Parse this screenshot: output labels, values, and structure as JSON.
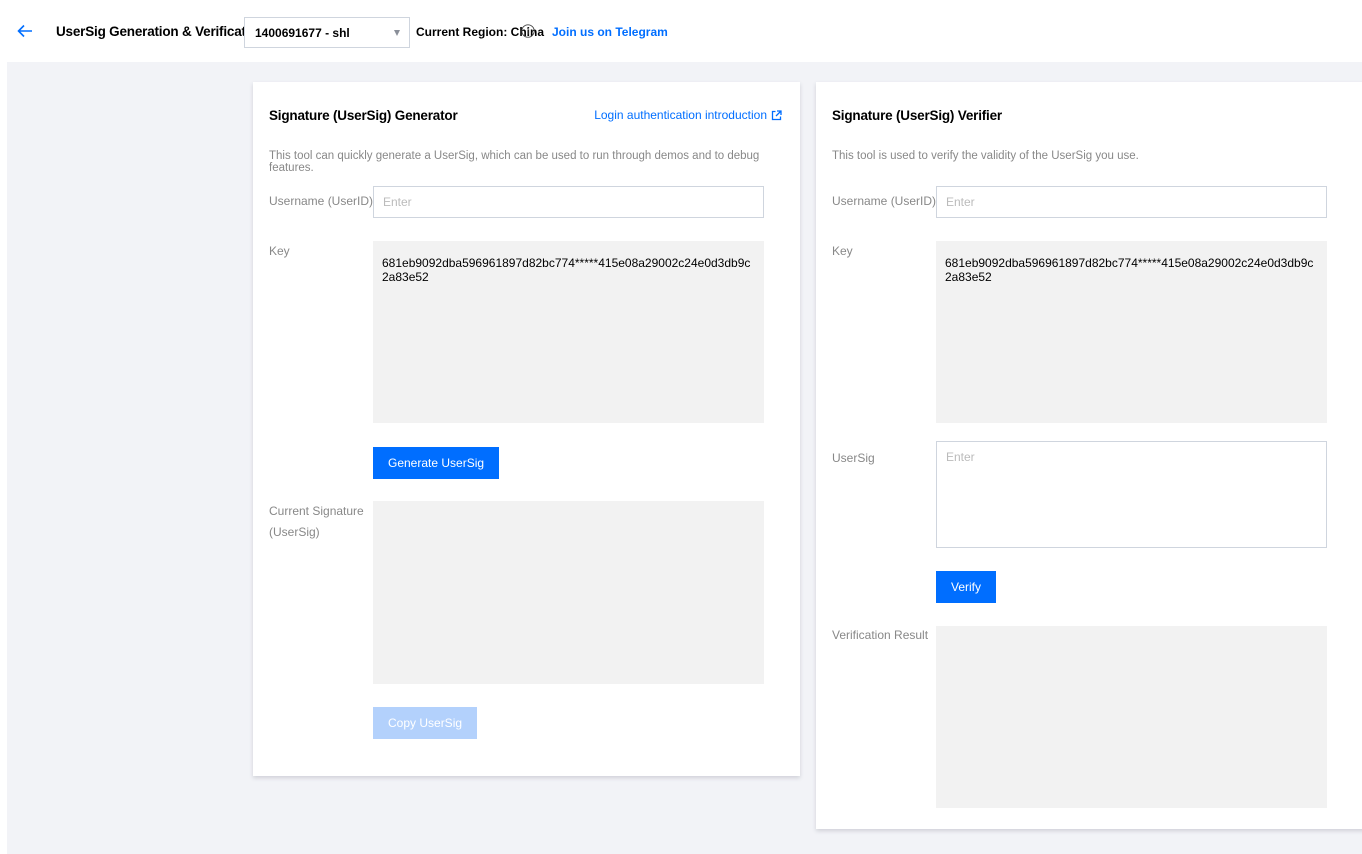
{
  "header": {
    "title": "UserSig Generation & Verification",
    "app_selector_value": "1400691677 - shl",
    "region_label": "Current Region: China",
    "telegram_link": "Join us on Telegram"
  },
  "generator": {
    "title": "Signature (UserSig) Generator",
    "doc_link": "Login authentication introduction",
    "description": "This tool can quickly generate a UserSig, which can be used to run through demos and to debug features.",
    "username_label": "Username (UserID)",
    "username_value": "",
    "username_placeholder": "Enter",
    "key_label": "Key",
    "key_value": "681eb9092dba596961897d82bc774*****415e08a29002c24e0d3db9c2a83e52",
    "generate_button": "Generate UserSig",
    "current_sig_label_line1": "Current Signature",
    "current_sig_label_line2": "(UserSig)",
    "current_sig_value": "",
    "copy_button": "Copy UserSig"
  },
  "verifier": {
    "title": "Signature (UserSig) Verifier",
    "description": "This tool is used to verify the validity of the UserSig you use.",
    "username_label": "Username (UserID)",
    "username_value": "",
    "username_placeholder": "Enter",
    "key_label": "Key",
    "key_value": "681eb9092dba596961897d82bc774*****415e08a29002c24e0d3db9c2a83e52",
    "usersig_label": "UserSig",
    "usersig_value": "",
    "usersig_placeholder": "Enter",
    "verify_button": "Verify",
    "result_label": "Verification Result",
    "result_value": ""
  },
  "icons": {
    "back": "arrow-left-icon",
    "dropdown": "caret-down-icon",
    "info": "info-circle-icon",
    "external_link": "external-link-icon"
  },
  "colors": {
    "accent": "#006eff",
    "disabled_button": "#b3d1fc",
    "page_background": "#f2f3f7",
    "readonly_background": "#f2f2f2"
  }
}
